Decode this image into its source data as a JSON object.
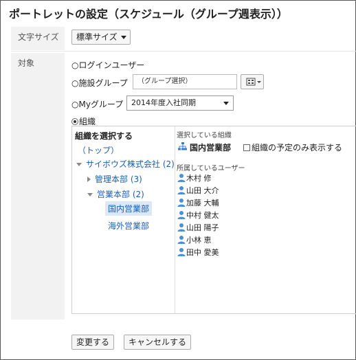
{
  "title": "ポートレットの設定（スケジュール（グループ週表示））",
  "font_size": {
    "label": "文字サイズ",
    "value": "標準サイズ"
  },
  "target": {
    "label": "対象",
    "options": {
      "login_user": "○ログインユーザー",
      "facility_group": "○施設グループ",
      "my_group": "○Myグループ",
      "organization": "組織"
    },
    "facility_placeholder": "（グループ選択）",
    "my_group_value": "2014年度入社同期"
  },
  "tree": {
    "heading": "組織を選択する",
    "items": [
      "（トップ）",
      "サイボウズ株式会社 (2)",
      "管理本部 (3)",
      "営業本部 (2)",
      "国内営業部",
      "海外営業部"
    ]
  },
  "selected": {
    "label": "選択している組織",
    "org": "国内営業部",
    "only_org_label": "組織の予定のみ表示する"
  },
  "members": {
    "label": "所属しているユーザー",
    "users": [
      "木村 修",
      "山田 大介",
      "加藤 大輔",
      "中村 健太",
      "山田 陽子",
      "小林 恵",
      "田中 愛美"
    ]
  },
  "buttons": {
    "save": "変更する",
    "cancel": "キャンセルする"
  },
  "colors": {
    "link": "#1a5fb4",
    "label_bg": "#f2f2f2",
    "selection_bg": "#dbe8f7"
  }
}
